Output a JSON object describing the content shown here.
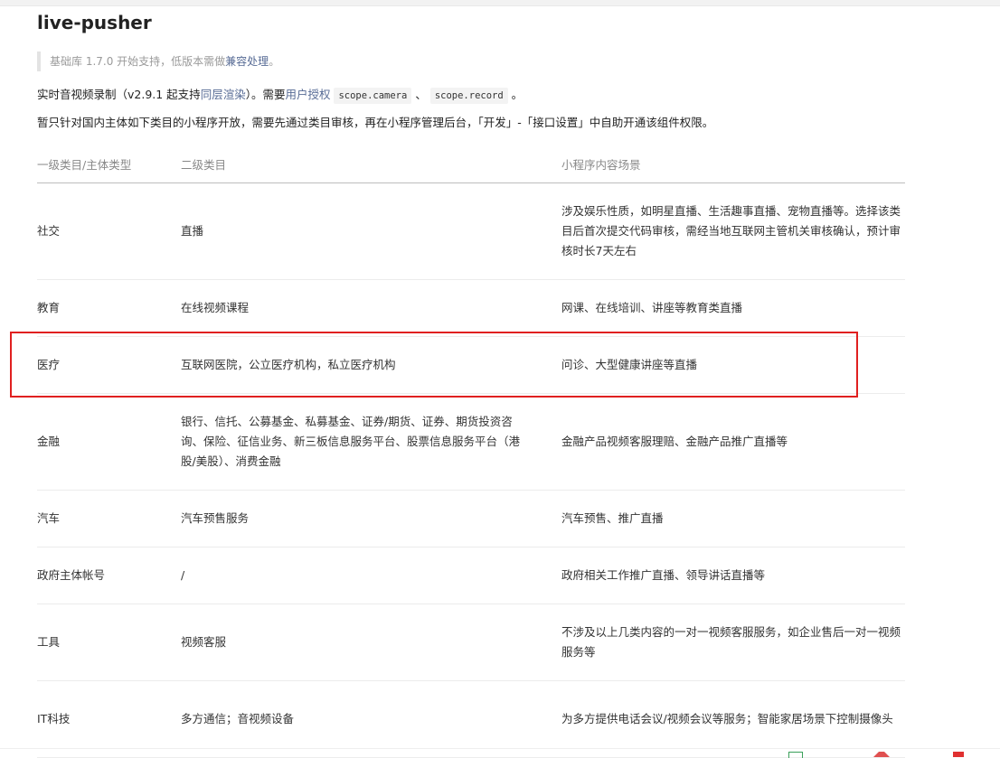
{
  "page": {
    "title": "live-pusher"
  },
  "tip": {
    "prefix": "基础库 1.7.0 开始支持，低版本需做",
    "link": "兼容处理",
    "suffix": "。"
  },
  "intro": {
    "t1": "实时音视频录制（v2.9.1 起支持",
    "link1": "同层渲染",
    "t2": "）。需要",
    "link2": "用户授权",
    "code1": "scope.camera",
    "sep": "、",
    "code2": "scope.record",
    "end": "。"
  },
  "notice": "暂只针对国内主体如下类目的小程序开放，需要先通过类目审核，再在小程序管理后台，「开发」-「接口设置」中自助开通该组件权限。",
  "table": {
    "headers": [
      "一级类目/主体类型",
      "二级类目",
      "小程序内容场景"
    ],
    "rows": [
      {
        "cat1": "社交",
        "cat2": "直播",
        "scene": "涉及娱乐性质，如明星直播、生活趣事直播、宠物直播等。选择该类目后首次提交代码审核，需经当地互联网主管机关审核确认，预计审核时长7天左右"
      },
      {
        "cat1": "教育",
        "cat2": "在线视频课程",
        "scene": "网课、在线培训、讲座等教育类直播"
      },
      {
        "cat1": "医疗",
        "cat2": "互联网医院，公立医疗机构，私立医疗机构",
        "scene": "问诊、大型健康讲座等直播"
      },
      {
        "cat1": "金融",
        "cat2": "银行、信托、公募基金、私募基金、证券/期货、证券、期货投资咨询、保险、征信业务、新三板信息服务平台、股票信息服务平台（港股/美股）、消费金融",
        "scene": "金融产品视频客服理赔、金融产品推广直播等"
      },
      {
        "cat1": "汽车",
        "cat2": "汽车预售服务",
        "scene": "汽车预售、推广直播"
      },
      {
        "cat1": "政府主体帐号",
        "cat2": "/",
        "scene": "政府相关工作推广直播、领导讲话直播等"
      },
      {
        "cat1": "工具",
        "cat2": "视频客服",
        "scene": "不涉及以上几类内容的一对一视频客服服务，如企业售后一对一视频服务等"
      },
      {
        "cat1": "IT科技",
        "cat2": "多方通信；音视频设备",
        "scene": "为多方提供电话会议/视频会议等服务；智能家居场景下控制摄像头"
      }
    ]
  },
  "colors": {
    "link": "#576b95",
    "highlight": "#e02020"
  }
}
